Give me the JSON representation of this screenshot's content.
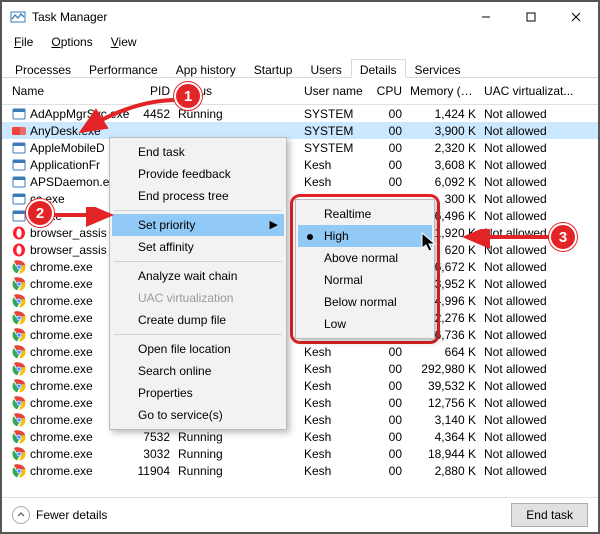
{
  "window": {
    "title": "Task Manager"
  },
  "menubar": [
    {
      "label": "File",
      "accel": "F"
    },
    {
      "label": "Options",
      "accel": "O"
    },
    {
      "label": "View",
      "accel": "V"
    }
  ],
  "tabs": [
    {
      "label": "Processes",
      "active": false
    },
    {
      "label": "Performance",
      "active": false
    },
    {
      "label": "App history",
      "active": false
    },
    {
      "label": "Startup",
      "active": false
    },
    {
      "label": "Users",
      "active": false
    },
    {
      "label": "Details",
      "active": true
    },
    {
      "label": "Services",
      "active": false
    }
  ],
  "columns": {
    "name": "Name",
    "pid": "PID",
    "status": "Status",
    "user": "User name",
    "cpu": "CPU",
    "mem": "Memory (a...",
    "uac": "UAC virtualizat..."
  },
  "rows": [
    {
      "icon": "app",
      "name": "AdAppMgrSvc.exe",
      "pid": "4452",
      "status": "Running",
      "user": "SYSTEM",
      "cpu": "00",
      "mem": "1,424 K",
      "uac": "Not allowed",
      "selected": false
    },
    {
      "icon": "anydesk",
      "name": "AnyDesk.exe",
      "pid": "",
      "status": "",
      "user": "SYSTEM",
      "cpu": "00",
      "mem": "3,900 K",
      "uac": "Not allowed",
      "selected": true
    },
    {
      "icon": "app",
      "name": "AppleMobileD",
      "pid": "",
      "status": "",
      "user": "SYSTEM",
      "cpu": "00",
      "mem": "2,320 K",
      "uac": "Not allowed",
      "selected": false
    },
    {
      "icon": "app",
      "name": "ApplicationFr",
      "pid": "",
      "status": "",
      "user": "Kesh",
      "cpu": "00",
      "mem": "3,608 K",
      "uac": "Not allowed",
      "selected": false
    },
    {
      "icon": "app",
      "name": "APSDaemon.e",
      "pid": "",
      "status": "",
      "user": "Kesh",
      "cpu": "00",
      "mem": "6,092 K",
      "uac": "Not allowed",
      "selected": false
    },
    {
      "icon": "app",
      "name": "cc.exe",
      "pid": "",
      "status": "",
      "user": "",
      "cpu": "",
      "mem": "300 K",
      "uac": "Not allowed",
      "selected": false
    },
    {
      "icon": "app",
      "name": "lg.exe",
      "pid": "",
      "status": "",
      "user": "",
      "cpu": "",
      "mem": "6,496 K",
      "uac": "Not allowed",
      "selected": false
    },
    {
      "icon": "opera",
      "name": "browser_assis",
      "pid": "",
      "status": "",
      "user": "",
      "cpu": "",
      "mem": "1,920 K",
      "uac": "Not allowed",
      "selected": false
    },
    {
      "icon": "opera",
      "name": "browser_assis",
      "pid": "",
      "status": "",
      "user": "",
      "cpu": "",
      "mem": "620 K",
      "uac": "Not allowed",
      "selected": false
    },
    {
      "icon": "chrome",
      "name": "chrome.exe",
      "pid": "",
      "status": "",
      "user": "",
      "cpu": "",
      "mem": "6,672 K",
      "uac": "Not allowed",
      "selected": false
    },
    {
      "icon": "chrome",
      "name": "chrome.exe",
      "pid": "",
      "status": "",
      "user": "",
      "cpu": "",
      "mem": "3,952 K",
      "uac": "Not allowed",
      "selected": false
    },
    {
      "icon": "chrome",
      "name": "chrome.exe",
      "pid": "",
      "status": "",
      "user": "",
      "cpu": "",
      "mem": "4,996 K",
      "uac": "Not allowed",
      "selected": false
    },
    {
      "icon": "chrome",
      "name": "chrome.exe",
      "pid": "",
      "status": "",
      "user": "",
      "cpu": "",
      "mem": "2,276 K",
      "uac": "Not allowed",
      "selected": false
    },
    {
      "icon": "chrome",
      "name": "chrome.exe",
      "pid": "",
      "status": "",
      "user": "Kesh",
      "cpu": "00",
      "mem": "156,736 K",
      "uac": "Not allowed",
      "selected": false
    },
    {
      "icon": "chrome",
      "name": "chrome.exe",
      "pid": "",
      "status": "",
      "user": "Kesh",
      "cpu": "00",
      "mem": "664 K",
      "uac": "Not allowed",
      "selected": false
    },
    {
      "icon": "chrome",
      "name": "chrome.exe",
      "pid": "",
      "status": "",
      "user": "Kesh",
      "cpu": "00",
      "mem": "292,980 K",
      "uac": "Not allowed",
      "selected": false
    },
    {
      "icon": "chrome",
      "name": "chrome.exe",
      "pid": "",
      "status": "",
      "user": "Kesh",
      "cpu": "00",
      "mem": "39,532 K",
      "uac": "Not allowed",
      "selected": false
    },
    {
      "icon": "chrome",
      "name": "chrome.exe",
      "pid": "2960",
      "status": "Running",
      "user": "Kesh",
      "cpu": "00",
      "mem": "12,756 K",
      "uac": "Not allowed",
      "selected": false
    },
    {
      "icon": "chrome",
      "name": "chrome.exe",
      "pid": "2652",
      "status": "Running",
      "user": "Kesh",
      "cpu": "00",
      "mem": "3,140 K",
      "uac": "Not allowed",
      "selected": false
    },
    {
      "icon": "chrome",
      "name": "chrome.exe",
      "pid": "7532",
      "status": "Running",
      "user": "Kesh",
      "cpu": "00",
      "mem": "4,364 K",
      "uac": "Not allowed",
      "selected": false
    },
    {
      "icon": "chrome",
      "name": "chrome.exe",
      "pid": "3032",
      "status": "Running",
      "user": "Kesh",
      "cpu": "00",
      "mem": "18,944 K",
      "uac": "Not allowed",
      "selected": false
    },
    {
      "icon": "chrome",
      "name": "chrome.exe",
      "pid": "11904",
      "status": "Running",
      "user": "Kesh",
      "cpu": "00",
      "mem": "2,880 K",
      "uac": "Not allowed",
      "selected": false
    }
  ],
  "footer": {
    "fewer_label": "Fewer details",
    "end_task_label": "End task"
  },
  "context_menu": {
    "items": [
      {
        "label": "End task",
        "type": "item"
      },
      {
        "label": "Provide feedback",
        "type": "item"
      },
      {
        "label": "End process tree",
        "type": "item"
      },
      {
        "type": "sep"
      },
      {
        "label": "Set priority",
        "type": "submenu",
        "highlight": true
      },
      {
        "label": "Set affinity",
        "type": "item"
      },
      {
        "type": "sep"
      },
      {
        "label": "Analyze wait chain",
        "type": "item"
      },
      {
        "label": "UAC virtualization",
        "type": "item",
        "disabled": true
      },
      {
        "label": "Create dump file",
        "type": "item"
      },
      {
        "type": "sep"
      },
      {
        "label": "Open file location",
        "type": "item"
      },
      {
        "label": "Search online",
        "type": "item"
      },
      {
        "label": "Properties",
        "type": "item"
      },
      {
        "label": "Go to service(s)",
        "type": "item"
      }
    ]
  },
  "priority_submenu": {
    "items": [
      {
        "label": "Realtime",
        "highlight": false,
        "current": false
      },
      {
        "label": "High",
        "highlight": true,
        "current": true
      },
      {
        "label": "Above normal",
        "highlight": false,
        "current": false
      },
      {
        "label": "Normal",
        "highlight": false,
        "current": false
      },
      {
        "label": "Below normal",
        "highlight": false,
        "current": false
      },
      {
        "label": "Low",
        "highlight": false,
        "current": false
      }
    ]
  },
  "callouts": {
    "1": "1",
    "2": "2",
    "3": "3"
  }
}
